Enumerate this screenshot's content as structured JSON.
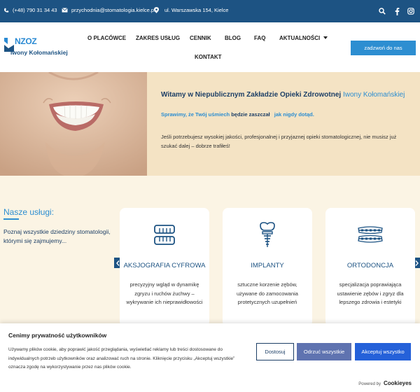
{
  "topbar": {
    "phone": "(+48) 790 31 34 43",
    "email": "przychodnia@stomatologia.kielce.pl",
    "address": "ul. Warszawska 154, Kielce"
  },
  "logo": {
    "top": "NZOZ",
    "bottom": "Iwony Kołomańskiej"
  },
  "nav": {
    "items": [
      "O PLACÓWCE",
      "ZAKRES USŁUG",
      "CENNIK",
      "BLOG",
      "FAQ",
      "AKTUALNOŚCI",
      "KONTAKT"
    ],
    "cta": "zadzwoń do nas"
  },
  "hero": {
    "title_main": "Witamy w Niepublicznym Zakładzie Opieki Zdrowotnej",
    "title_name": "Iwony Kołomańskiej",
    "tag_a": "Sprawimy, że Twój uśmiech",
    "tag_b": "będzie",
    "tag_c": "zaszczał",
    "tag_d": "jak nigdy dotąd.",
    "description": "Jeśli potrzebujesz wysokiej jakości, profesjonalnej i przyjaznej opieki stomatologicznej, nie musisz już szukać dalej – dobrze trafiłeś!"
  },
  "services": {
    "title": "Nasze usługi:",
    "subtitle": "Poznaj wszystkie dziedziny stomatologii, którymi się zajmujemy...",
    "cards": [
      {
        "title": "AKSJOGRAFIA CYFROWA",
        "desc": "precyzyjny wgląd w dynamikę zgryzu i ruchów żuchwy – wykrywanie ich nieprawidłowości",
        "icon": "dentures-icon"
      },
      {
        "title": "IMPLANTY",
        "desc": "sztuczne korzenie zębów, używane do zamocowania protetycznych uzupełnień",
        "icon": "dental-implant-icon"
      },
      {
        "title": "ORTODONCJA",
        "desc": "specjalizacja poprawiająca ustawienie zębów i zgryz dla lepszego zdrowia i estetyki",
        "icon": "braces-icon"
      }
    ]
  },
  "cookie": {
    "title": "Cenimy prywatność użytkowników",
    "text": "Używamy plików cookie, aby poprawić jakość przeglądania, wyświetlać reklamy lub treści dostosowane do indywidualnych potrzeb użytkowników oraz analizować ruch na stronie. Kliknięcie przycisku „Akceptuj wszystkie” oznacza zgodę na wykorzystywanie przez nas plików cookie.",
    "btn_customize": "Dostosuj",
    "btn_reject": "Odrzuć wszystkie",
    "btn_accept": "Akceptuj wszystko",
    "powered": "Powered by",
    "brand": "Cookieyes"
  },
  "colors": {
    "primary": "#1d5383",
    "accent": "#2d8ed1",
    "hero_bg": "#f4e3c4",
    "page_bg": "#fbf4e4"
  }
}
